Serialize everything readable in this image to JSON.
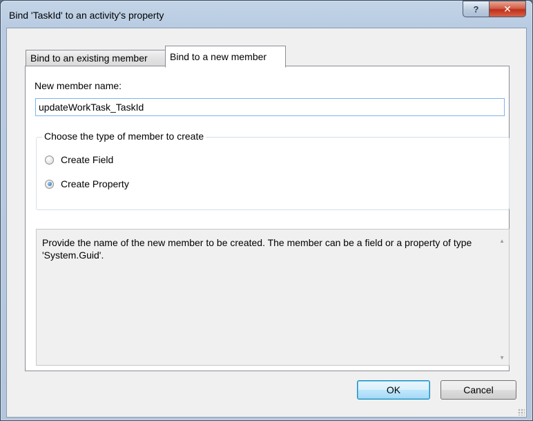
{
  "window": {
    "title": "Bind 'TaskId' to an activity's property",
    "help_glyph": "?",
    "close_glyph": "✕"
  },
  "tabs": [
    {
      "label": "Bind to an existing member",
      "active": false
    },
    {
      "label": "Bind to a new member",
      "active": true
    }
  ],
  "form": {
    "member_name_label": "New member name:",
    "member_name_value": "updateWorkTask_TaskId",
    "member_type_group": "Choose the type of member to create",
    "options": [
      {
        "label": "Create Field",
        "selected": false
      },
      {
        "label": "Create Property",
        "selected": true
      }
    ],
    "description": "Provide the name of the new member to be created. The member can be a field or a property of type 'System.Guid'."
  },
  "buttons": {
    "ok": "OK",
    "cancel": "Cancel"
  },
  "icons": {
    "scroll_up": "up-arrow-icon",
    "scroll_down": "down-arrow-icon",
    "resize_grip": "resize-grip-icon"
  },
  "colors": {
    "accent_border": "#7eb4ea",
    "default_button": "#3c7fb1",
    "close_button": "#c0301a"
  }
}
